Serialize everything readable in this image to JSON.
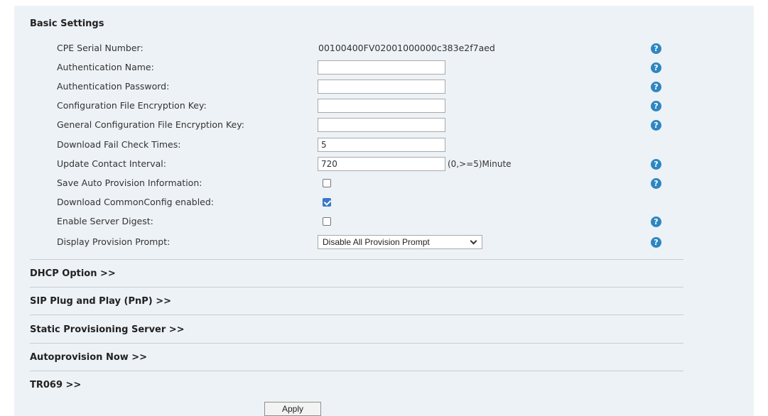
{
  "section": {
    "title": "Basic Settings"
  },
  "help_glyph": "?",
  "fields": {
    "cpe_serial": {
      "label": "CPE Serial Number:",
      "value": "00100400FV02001000000c383e2f7aed"
    },
    "auth_name": {
      "label": "Authentication Name:",
      "value": ""
    },
    "auth_password": {
      "label": "Authentication Password:",
      "value": ""
    },
    "config_key": {
      "label": "Configuration File Encryption Key:",
      "value": ""
    },
    "general_config_key": {
      "label": "General Configuration File Encryption Key:",
      "value": ""
    },
    "download_fail": {
      "label": "Download Fail Check Times:",
      "value": "5"
    },
    "update_interval": {
      "label": "Update Contact Interval:",
      "value": "720",
      "unit": "(0,>=5)Minute"
    },
    "save_auto": {
      "label": "Save Auto Provision Information:",
      "checked": false
    },
    "download_common": {
      "label": "Download CommonConfig enabled:",
      "checked": true
    },
    "server_digest": {
      "label": "Enable Server Digest:",
      "checked": false
    },
    "provision_prompt": {
      "label": "Display Provision Prompt:",
      "selected": "Disable All Provision Prompt"
    }
  },
  "collapsibles": {
    "dhcp": "DHCP Option >>",
    "sip_pnp": "SIP Plug and Play (PnP) >>",
    "static_server": "Static Provisioning Server >>",
    "autoprovision_now": "Autoprovision Now >>",
    "tr069": "TR069 >>"
  },
  "apply_label": "Apply",
  "colors": {
    "panel_bg": "#edf2f6",
    "help_icon": "#2e86c1",
    "checkbox_checked": "#3a78c9"
  }
}
